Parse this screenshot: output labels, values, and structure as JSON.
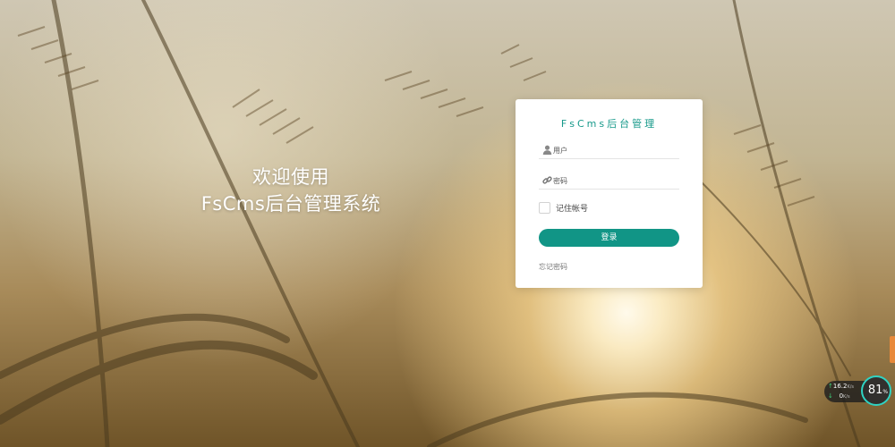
{
  "welcome": {
    "line1": "欢迎使用",
    "line2": "FsCms后台管理系统"
  },
  "login": {
    "title": "FsCms后台管理",
    "username_placeholder": "用户",
    "password_placeholder": "密码",
    "remember_label": "记住帐号",
    "remember_checked": false,
    "submit_label": "登录",
    "forgot_label": "忘记密码"
  },
  "monitor": {
    "upload_value": "16.2",
    "upload_unit": "K/s",
    "download_value": "0",
    "download_unit": "K/s",
    "percent": "81",
    "percent_sign": "%"
  },
  "colors": {
    "accent": "#119586",
    "title": "#16998a"
  }
}
